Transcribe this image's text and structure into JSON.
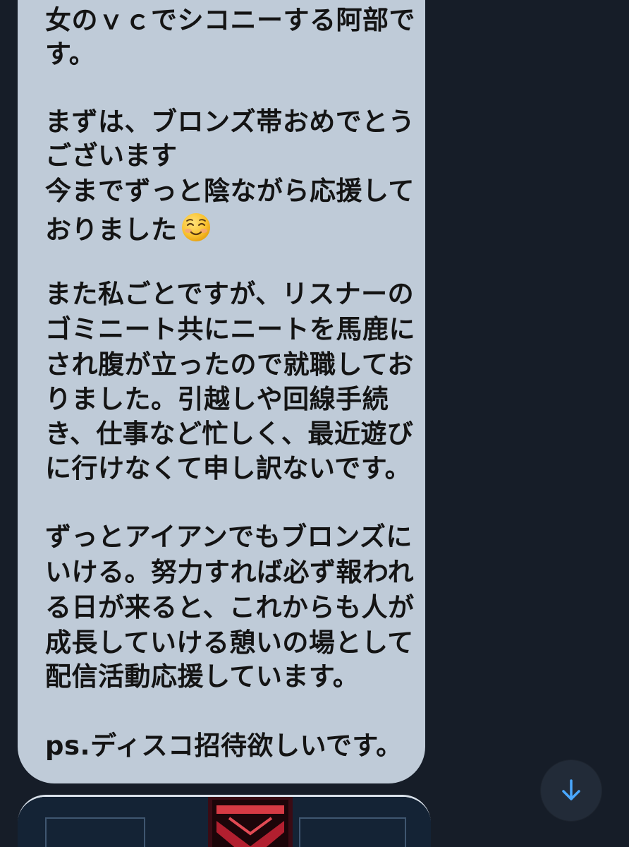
{
  "message": {
    "lines": [
      "女のｖｃでシコニーする阿部で",
      "す。",
      "まずは、ブロンズ帯おめでとう",
      "ございます",
      "今までずっと陰ながら応援して",
      "おりました",
      "また私ごとですが、リスナーの",
      "ゴミニート共にニートを馬鹿に",
      "され腹が立ったので就職してお",
      "りました。引越しや回線手続",
      "き、仕事など忙しく、最近遊び",
      "に行けなくて申し訳ないです。",
      "ずっとアイアンでもブロンズに",
      "いける。努力すれば必ず報われ",
      "る日が来ると、これからも人が",
      "成長していける憩いの場として",
      "配信活動応援しています。",
      "ps.ディスコ招待欲しいです。"
    ],
    "emoji": "smiling-face-icon"
  },
  "scroll_button": {
    "icon": "arrow-down-icon"
  },
  "colors": {
    "background": "#161d28",
    "bubble": "#bfcbd8",
    "text": "#141414",
    "accent": "#4aa8ff"
  }
}
